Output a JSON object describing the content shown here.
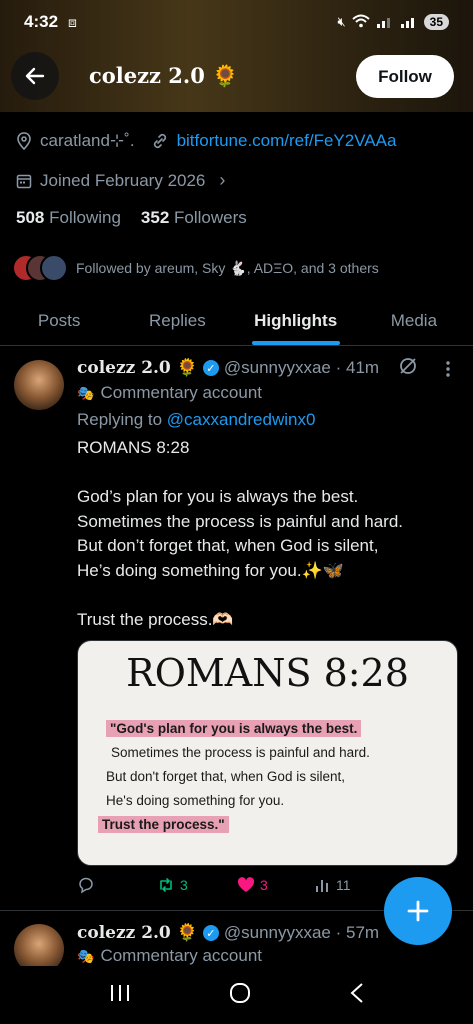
{
  "status_bar": {
    "time": "4:32",
    "battery": "35"
  },
  "header": {
    "title": "colezz 2.0 🌻",
    "follow_label": "Follow"
  },
  "profile": {
    "location": "caratland⊹˚.",
    "link": "bitfortune.com/ref/FeY2VAAa",
    "joined": "Joined February 2026",
    "following_count": "508",
    "following_label": "Following",
    "followers_count": "352",
    "followers_label": "Followers",
    "followed_by": "Followed by areum, Sky 🐇, ADΞO, and 3 others"
  },
  "tabs": [
    "Posts",
    "Replies",
    "Highlights",
    "Media"
  ],
  "active_tab": "Highlights",
  "tweet1": {
    "name": "colezz 2.0 🌻",
    "handle": "@sunnyyxxae · 41m",
    "badge_emoji": "🎭",
    "commentary": "Commentary account",
    "reply_prefix": "Replying to",
    "reply_mention": "@caxxandredwinx0",
    "text_lines": [
      "ROMANS 8:28",
      "",
      "God’s plan for you is always the best.",
      "Sometimes the process is painful and hard.",
      "But don’t forget that, when God is silent,",
      "He’s doing something for you.✨🦋",
      "",
      "Trust the process.🫶🏻"
    ],
    "image": {
      "title": "ROMANS 8:28",
      "line1": "\"God's plan for you is always the best.",
      "line2": "Sometimes the process is painful and hard.",
      "line3": "But don't forget that, when God is silent,",
      "line4": "He's doing something for you.",
      "line5": "Trust the process.\""
    },
    "retweets": "3",
    "likes": "3",
    "views": "11"
  },
  "tweet2": {
    "name": "colezz 2.0 🌻",
    "handle": "@sunnyyxxae · 57m",
    "badge_emoji": "🎭",
    "commentary": "Commentary account"
  },
  "colors": {
    "accent": "#1d9bf0",
    "like": "#f91880",
    "retweet": "#00ba7c",
    "background": "#000000"
  }
}
